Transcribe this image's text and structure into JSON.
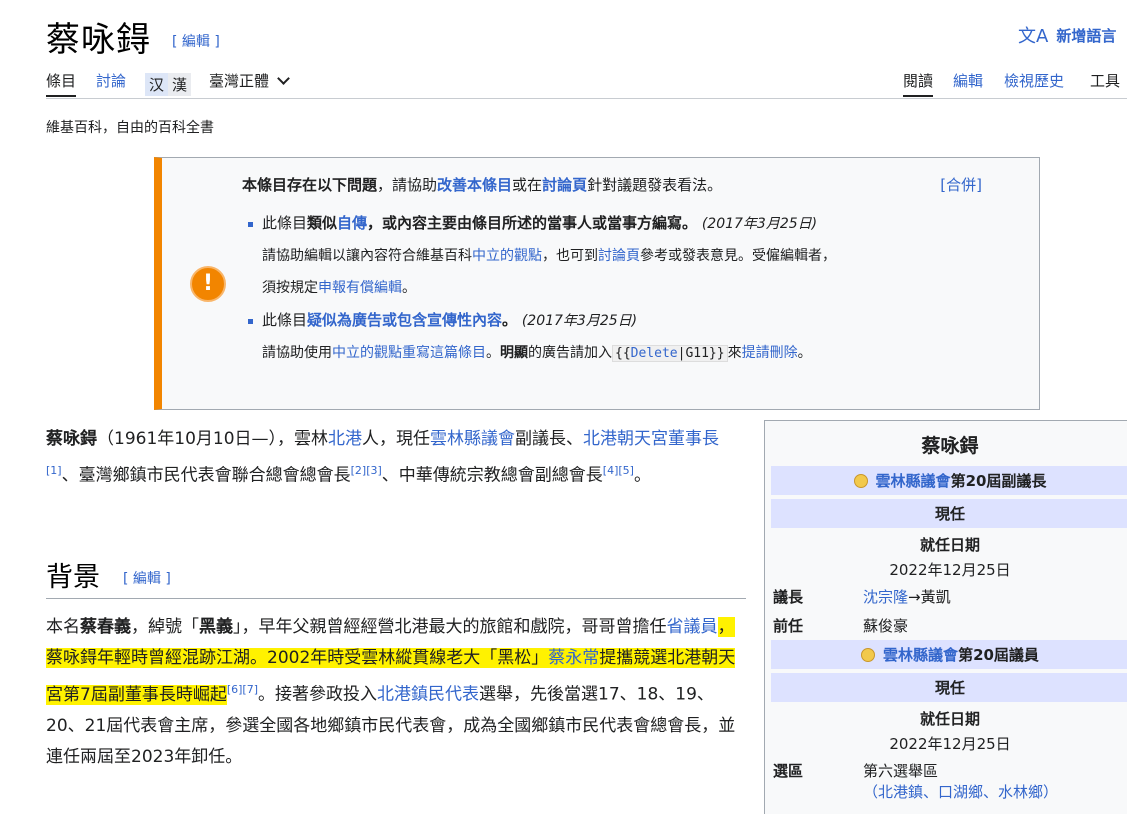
{
  "header": {
    "title": "蔡咏鍀",
    "edit_label": "[ 編輯 ]",
    "add_lang": "新增語言"
  },
  "tabs": {
    "article": "條目",
    "talk": "討論",
    "variant_1": "汉",
    "variant_2": "漢",
    "variant_select": "臺灣正體",
    "read": "閱讀",
    "edit": "編輯",
    "history": "檢視歷史",
    "tools": "工具"
  },
  "tagline": "維基百科，自由的百科全書",
  "ambox": {
    "head_bold": "本條目存在以下問題",
    "head_1": "，請協助",
    "head_link1": "改善本條目",
    "head_2": "或在",
    "head_link2": "討論頁",
    "head_3": "針對議題發表看法。",
    "merge": "[合併]",
    "issue1_pre": "此條目",
    "issue1_bold": "類似",
    "issue1_link": "自傳",
    "issue1_rest": "，或內容主要由條目所述的當事人或當事方編寫。",
    "issue1_date": "(2017年3月25日)",
    "issue1_sub1": "請協助編輯以讓內容符合維基百科",
    "issue1_sub_link1": "中立的觀點",
    "issue1_sub2": "，也可到",
    "issue1_sub_link2": "討論頁",
    "issue1_sub3": "參考或發表意見。受僱編輯者，",
    "issue1_sub4": "須按規定",
    "issue1_sub_link3": "申報有償編輯",
    "issue1_sub5": "。",
    "issue2_pre": "此條目",
    "issue2_link": "疑似為廣告或包含宣傳性內容",
    "issue2_rest": "。",
    "issue2_date": "(2017年3月25日)",
    "issue2_sub1": "請協助使用",
    "issue2_sub_link1": "中立的觀點重寫這篇條目",
    "issue2_sub2": "。",
    "issue2_sub_bold": "明顯",
    "issue2_sub3": "的廣告請加入",
    "issue2_tpl_open": "{{",
    "issue2_tpl_link": "Delete",
    "issue2_tpl_rest": "|G11}}",
    "issue2_sub4": "來",
    "issue2_sub_link2": "提請刪除",
    "issue2_sub5": "。"
  },
  "lead": {
    "name": "蔡咏鍀",
    "t1": "（1961年10月10日—），雲林",
    "l1": "北港",
    "t2": "人，現任",
    "l2": "雲林縣議會",
    "t3": "副議長、",
    "l3": "北港朝天宮董事長",
    "r1": "[1]",
    "t4": "、臺灣鄉鎮市民代表會聯合總會總會長",
    "r2": "[2]",
    "r3": "[3]",
    "t5": "、中華傳統宗教總會副總會長",
    "r4": "[4]",
    "r5": "[5]",
    "t6": "。"
  },
  "section": {
    "heading": "背景",
    "edit_label": "[ 編輯 ]",
    "p1": "本名",
    "b1": "蔡春義",
    "p2": "，綽號「",
    "b2": "黑義",
    "p3": "」，早年父親曾經經營北港最大的旅館和戲院，哥哥曾擔任",
    "l1": "省議員",
    "h1": "，蔡咏鍀年輕時曾經混跡江湖。2002年時受雲林縱貫線老大「黑松」",
    "l2": "蔡永常",
    "h2": "提攜競選北港朝天宮第7屆副董事長時崛起",
    "r6": "[6]",
    "r7": "[7]",
    "p4": "。接著參政投入",
    "l3": "北港鎮民代表",
    "p5": "選舉，先後當選17、18、19、20、21屆代表會主席，參選全國各地鄉鎮市民代表會，成為全國鄉鎮市民代表會總會長，並連任兩屆至2023年卸任。"
  },
  "infobox": {
    "title": "蔡咏鍀",
    "band1_link": "雲林縣議會",
    "band1_rest": "第20屆副議長",
    "current1": "現任",
    "start_label1": "就任日期",
    "start_date1": "2022年12月25日",
    "speaker_label": "議長",
    "speaker_link": "沈宗隆",
    "speaker_rest": "→黃凱",
    "predecessor_label": "前任",
    "predecessor_value": "蘇俊豪",
    "band2_link": "雲林縣議會",
    "band2_rest": "第20屆議員",
    "current2": "現任",
    "start_label2": "就任日期",
    "start_date2": "2022年12月25日",
    "district_label": "選區",
    "district_value": "第六選舉區",
    "district_sub": "（北港鎮、口湖鄉、水林鄉）"
  }
}
